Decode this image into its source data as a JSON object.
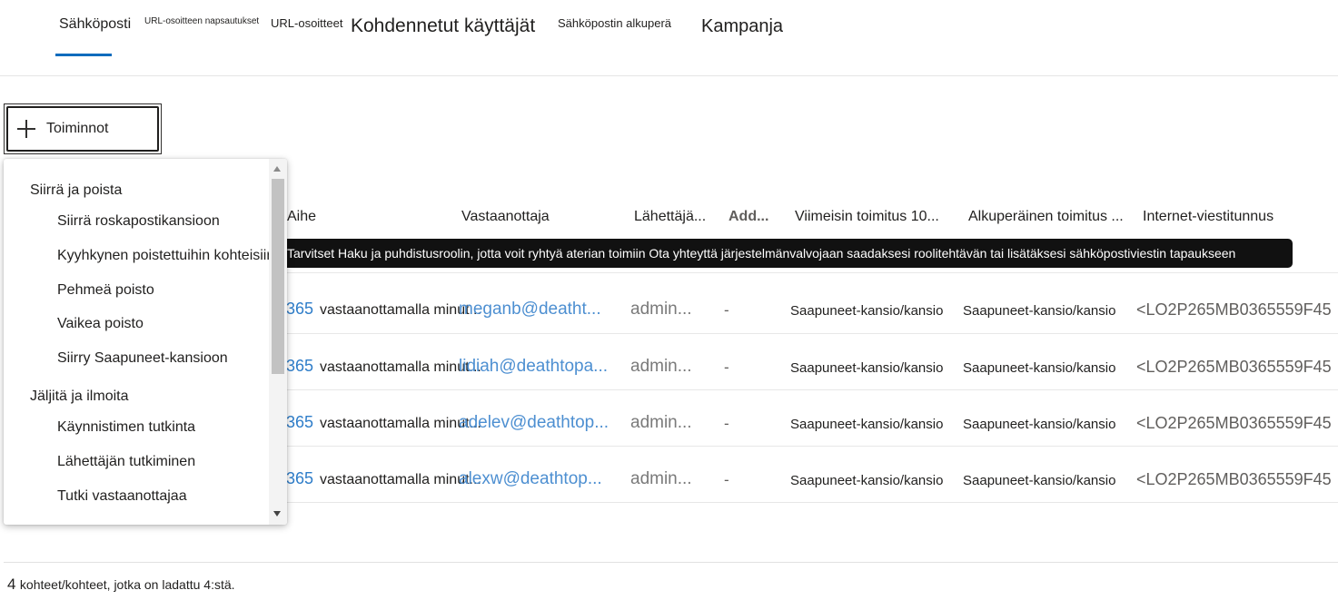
{
  "tabs": [
    {
      "label": "Sähköposti"
    },
    {
      "label": "URL-osoitteen napsautukset"
    },
    {
      "label": "URL-osoitteet"
    },
    {
      "label": "Kohdennetut käyttäjät"
    },
    {
      "label": "Sähköpostin alkuperä"
    },
    {
      "label": "Kampanja"
    }
  ],
  "toolbar": {
    "actions_label": "Toiminnot"
  },
  "columns": [
    "Aihe",
    "Vastaanottaja",
    "Lähettäjä...",
    "Add...",
    "Viimeisin toimitus 10...",
    "Alkuperäinen toimitus ...",
    "Internet-viestitunnus"
  ],
  "rows": [
    {
      "subject_num": "365",
      "subject": "vastaanottamalla minut...",
      "recipient": "meganb@deatht...",
      "sender": "admin...",
      "add": "-",
      "latest": "Saapuneet-kansio/kansio",
      "original": "Saapuneet-kansio/kansio",
      "msgid": "<LO2P265MB0365559F45"
    },
    {
      "subject_num": "365",
      "subject": "vastaanottamalla minut...",
      "recipient": "lidiah@deathtopa...",
      "sender": "admin...",
      "add": "-",
      "latest": "Saapuneet-kansio/kansio",
      "original": "Saapuneet-kansio/kansio",
      "msgid": "<LO2P265MB0365559F45"
    },
    {
      "subject_num": "365",
      "subject": "vastaanottamalla minut...",
      "recipient": "adelev@deathtop...",
      "sender": "admin...",
      "add": "-",
      "latest": "Saapuneet-kansio/kansio",
      "original": "Saapuneet-kansio/kansio",
      "msgid": "<LO2P265MB0365559F45"
    },
    {
      "subject_num": "365",
      "subject": "vastaanottamalla minut...",
      "recipient": "alexw@deathtop...",
      "sender": "admin...",
      "add": "-",
      "latest": "Saapuneet-kansio/kansio",
      "original": "Saapuneet-kansio/kansio",
      "msgid": "<LO2P265MB0365559F45"
    }
  ],
  "tooltip": "Tarvitset Haku ja puhdistusroolin, jotta voit ryhtyä aterian toimiin Ota yhteyttä järjestelmänvalvojaan saadaksesi roolitehtävän tai lisätäksesi sähköpostiviestin tapaukseen",
  "dropdown": {
    "groups": [
      {
        "label": "Siirrä ja poista",
        "items": [
          "Siirrä roskapostikansioon",
          "Kyyhkynen poistettuihin kohteisiin",
          "Pehmeä poisto",
          "Vaikea poisto",
          "Siirry Saapuneet-kansioon"
        ]
      },
      {
        "label": "Jäljitä ja ilmoita",
        "items": [
          "Käynnistimen tutkinta",
          "Lähettäjän tutkiminen",
          "Tutki vastaanottajaa"
        ]
      }
    ]
  },
  "footer": {
    "count": "4",
    "text": "kohteet/kohteet, jotka on ladattu 4:stä."
  },
  "colors": {
    "accent": "#0f6cbd",
    "link": "#4d8fd1",
    "tooltip_bg": "#111111"
  }
}
